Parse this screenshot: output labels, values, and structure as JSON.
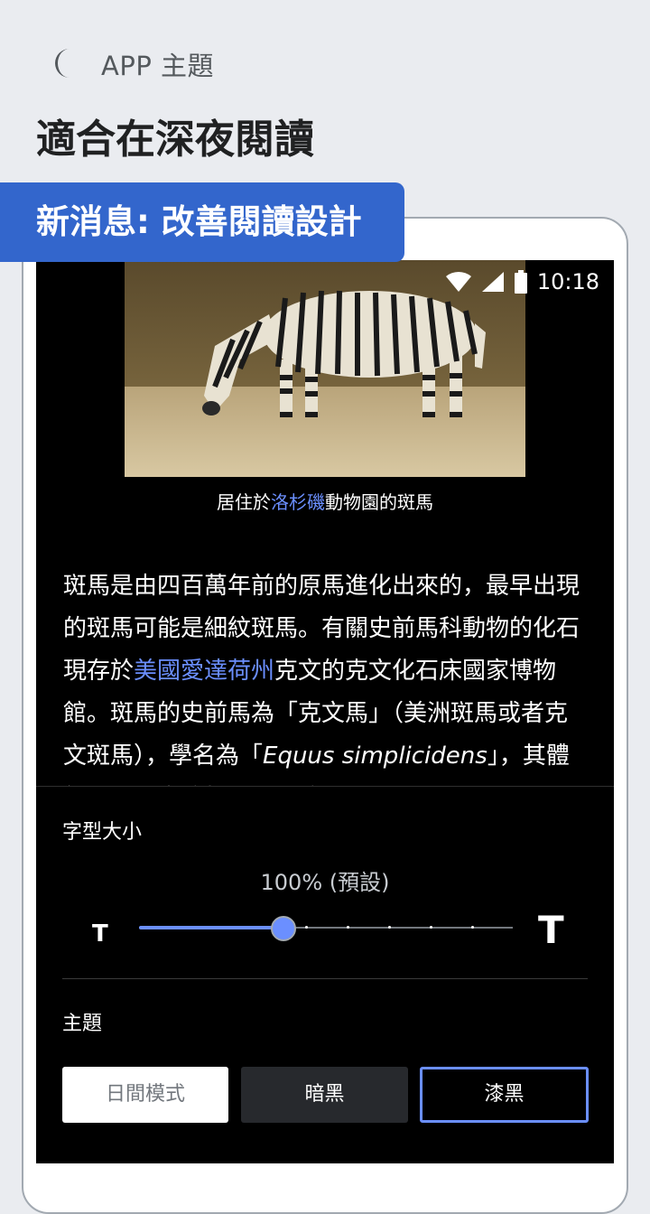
{
  "header": {
    "icon": "moon-icon",
    "app_theme_label": "APP 主題",
    "headline": "適合在深夜閱讀"
  },
  "banner": {
    "text": "新消息: 改善閱讀設計"
  },
  "status_bar": {
    "time": "10:18",
    "icons": [
      "wifi-icon",
      "signal-icon",
      "battery-icon"
    ]
  },
  "article": {
    "image_alt": "zebra",
    "caption_prefix": "居住於",
    "caption_link": "洛杉磯",
    "caption_suffix": "動物園的斑馬",
    "p1": "斑馬是由四百萬年前的原馬進化出來的，最早出現的斑馬可能是細紋斑馬。有關史前馬科動物的化石現存於",
    "p1_link": "美國愛達荷州",
    "p2": "克文的克文化石床國家博物館。斑馬的史前馬為「克文馬」（美洲斑馬或者克文斑馬），學名為「",
    "p2_italic": "Equus simplicidens",
    "p3": "」，其體態跟斑馬大致相同，骨骼"
  },
  "settings": {
    "font_size_label": "字型大小",
    "font_size_value": "100% (預設)",
    "font_size_level": 0.385,
    "font_size_steps": 9,
    "small_t": "T",
    "large_t": "T",
    "theme_label": "主題",
    "themes": [
      {
        "label": "日間模式",
        "selected": false
      },
      {
        "label": "暗黑",
        "selected": false
      },
      {
        "label": "漆黑",
        "selected": true
      }
    ]
  },
  "colors": {
    "accent": "#3366cc",
    "link": "#6b8fff",
    "background": "#eaecf0",
    "screen": "#000000"
  }
}
